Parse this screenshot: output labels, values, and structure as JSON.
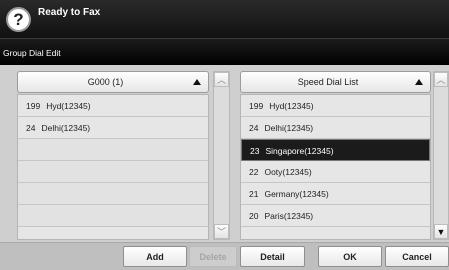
{
  "header": {
    "status": "Ready to Fax"
  },
  "subheader": {
    "title": "Group Dial Edit"
  },
  "left_panel": {
    "title": "G000 (1)",
    "rows": [
      {
        "num": "199",
        "name": "Hyd(12345)"
      },
      {
        "num": "24",
        "name": "Delhi(12345)"
      }
    ]
  },
  "right_panel": {
    "title": "Speed Dial List",
    "rows": [
      {
        "num": "199",
        "name": "Hyd(12345)"
      },
      {
        "num": "24",
        "name": "Delhi(12345)"
      },
      {
        "num": "23",
        "name": "Singapore(12345)"
      },
      {
        "num": "22",
        "name": "Ooty(12345)"
      },
      {
        "num": "21",
        "name": "Germany(12345)"
      },
      {
        "num": "20",
        "name": "Paris(12345)"
      }
    ],
    "selected_index": 2
  },
  "icons": {
    "help": "help-icon",
    "sort": "sort-up-icon",
    "scroll_up": "scroll-up-icon",
    "scroll_down": "scroll-down-icon"
  },
  "buttons": {
    "add": "Add",
    "delete": "Delete",
    "detail": "Detail",
    "ok": "OK",
    "cancel": "Cancel"
  },
  "glyphs": {
    "help": "?",
    "up": "▲",
    "down": "▼",
    "up_light": "︿",
    "down_light": "﹀"
  }
}
